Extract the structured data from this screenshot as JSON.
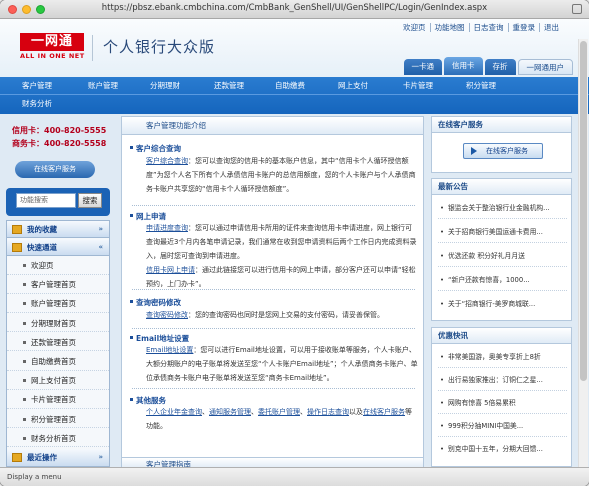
{
  "browser": {
    "url": "https://pbsz.ebank.cmbchina.com/CmbBank_GenShell/UI/GenShellPC/Login/GenIndex.aspx",
    "status": "Display a menu"
  },
  "header": {
    "logo_text": "一网通",
    "logo_sub": "ALL IN ONE NET",
    "brand": "个人银行大众版",
    "top_links": [
      "欢迎页",
      "功能地图",
      "日志查询",
      "重登录",
      "退出"
    ],
    "card_tabs": [
      "一卡通",
      "信用卡",
      "存折",
      "一网通用户"
    ]
  },
  "nav": {
    "row1": [
      "客户管理",
      "账户管理",
      "分期理财",
      "还款管理",
      "自助缴费",
      "网上支付",
      "卡片管理",
      "积分管理"
    ],
    "row2": [
      "财务分析"
    ]
  },
  "left": {
    "hotline_credit": "信用卡：400-820-5555",
    "hotline_debit": "商务卡：400-820-5558",
    "service_btn": "在线客户服务",
    "search_placeholder": "功能搜索",
    "search_btn": "搜索",
    "menu_fav": "我的收藏",
    "menu_quick": "快速通道",
    "quick_items": [
      "欢迎页",
      "客户管理首页",
      "账户管理首页",
      "分期理财首页",
      "还款管理首页",
      "自助缴费首页",
      "网上支付首页",
      "卡片管理首页",
      "积分管理首页",
      "财务分析首页"
    ],
    "menu_recent": "最近操作"
  },
  "center": {
    "title": "客户管理功能介绍",
    "sections": [
      {
        "title": "客户综合查询",
        "link": "客户综合查询",
        "text": "：您可以查询您的信用卡的基本账户信息，其中“信用卡个人循环授信额度”为您个人名下所有个人承债信用卡账户的总信用额度，您的个人卡账户与个人承债商务卡账户共享您的“信用卡个人循环授信额度”。"
      },
      {
        "title": "网上申请",
        "link": "申请进度查询",
        "text": "：您可以通过申请信用卡所用的证件来查询信用卡申请进度，网上银行可查询最近3个月内各笔申请记录，我们通常在收到您申请资料后两个工作日内完成资料录入，届时您可查询到申请进度。",
        "link2": "信用卡网上申请",
        "text2": "：通过此链接您可以进行信用卡的网上申请，部分客户还可以申请“轻松预约，上门办卡”。"
      },
      {
        "title": "查询密码修改",
        "link": "查询密码修改",
        "text": "：您的查询密码也同时是您网上交易的支付密码，请妥善保管。"
      },
      {
        "title": "Email地址设置",
        "link": "Email地址设置",
        "text": "：您可以进行Email地址设置，可以用于接收账单等服务，个人卡账户、大额分期账户的电子账单将发送至您“个人卡账户Email地址”；个人承债商务卡账户、单位承债商务卡账户电子账单将发送至您“商务卡Email地址”。"
      },
      {
        "title": "其他服务",
        "links": [
          "个人企业年金查询",
          "通知服务管理",
          "委托账户管理",
          "操作日志查询"
        ],
        "joiner": "、",
        "and": "以及",
        "last": "在线客户服务",
        "tail": "等功能。"
      }
    ],
    "footer_title": "客户管理指南"
  },
  "right": {
    "online_title": "在线客户服务",
    "online_btn": "在线客户服务",
    "news_title": "最新公告",
    "news": [
      "银监会关于整治银行业金融机构...",
      "关于招商银行美国运通卡费用...",
      "优选还款 积分好礼月月送",
      "“新户还款有惊喜，1000...",
      "关于“招商银行-美罗商城联..."
    ],
    "promo_title": "优惠快讯",
    "promos": [
      "非常美国游，奥美专享折上8折",
      "出行易独家推出：订铜仁之星...",
      "网购有惊喜 5倍易累积",
      "999积分抽MINI中国美...",
      "别克中国十五年，分期大回馈..."
    ]
  }
}
